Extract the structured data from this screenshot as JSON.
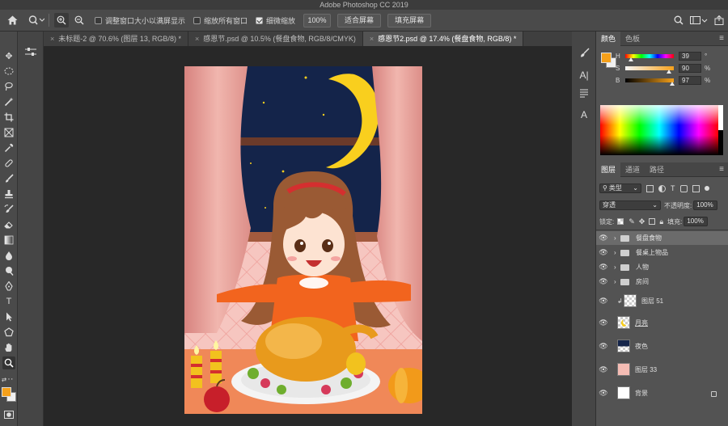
{
  "app_title": "Adobe Photoshop CC 2019",
  "options_bar": {
    "resize_windows_label": "调整窗口大小以满屏显示",
    "resize_windows_checked": false,
    "zoom_all_label": "缩放所有窗口",
    "zoom_all_checked": false,
    "scrubby_zoom_label": "细微缩放",
    "scrubby_zoom_checked": true,
    "zoom_value": "100%",
    "fit_screen_label": "适合屏幕",
    "fill_screen_label": "填充屏幕"
  },
  "tabs": [
    {
      "label": "未标题-2 @ 70.6% (图层 13, RGB/8) *",
      "active": false
    },
    {
      "label": "感恩节.psd @ 10.5% (餐盘食物, RGB/8/CMYK)",
      "active": false
    },
    {
      "label": "感恩节2.psd @ 17.4% (餐盘食物, RGB/8) *",
      "active": true
    }
  ],
  "color_panel": {
    "tab_color": "颜色",
    "tab_swatches": "色板",
    "foreground": "#f5a01a",
    "background": "#f0f0f0",
    "h_label": "H",
    "h_value": "39",
    "h_unit": "°",
    "s_label": "S",
    "s_value": "90",
    "s_unit": "%",
    "b_label": "B",
    "b_value": "97",
    "b_unit": "%",
    "h_level": 0.11,
    "s_level": 0.9,
    "b_level": 0.97
  },
  "layers_panel": {
    "tab_layers": "图层",
    "tab_channels": "通道",
    "tab_paths": "路径",
    "filter_label": "类型",
    "blend_mode": "穿透",
    "opacity_label": "不透明度:",
    "opacity_value": "100%",
    "lock_label": "锁定:",
    "fill_label": "填充:",
    "fill_value": "100%",
    "layers": [
      {
        "name": "餐盘食物",
        "kind": "group",
        "selected": true
      },
      {
        "name": "餐桌上物品",
        "kind": "group",
        "selected": false
      },
      {
        "name": "人物",
        "kind": "group",
        "selected": false
      },
      {
        "name": "房间",
        "kind": "group",
        "selected": false
      },
      {
        "name": "图层 51",
        "kind": "layer",
        "thumb": "checker",
        "clipped": true
      },
      {
        "name": "月亮",
        "kind": "layer",
        "thumb": "moon"
      },
      {
        "name": "夜色",
        "kind": "layer",
        "thumb": "night"
      },
      {
        "name": "图层 33",
        "kind": "layer",
        "thumb": "pink"
      },
      {
        "name": "背景",
        "kind": "layer",
        "thumb": "white",
        "locked": true
      }
    ]
  },
  "colors": {
    "night": "#14244a",
    "curtain": "#e8a09a",
    "wall": "#f6c6c0",
    "sweater": "#f2641e",
    "hair": "#9a5a34",
    "turkey": "#e89a1c",
    "moon": "#f9cf1e",
    "accent_fg": "#f5a01a"
  }
}
